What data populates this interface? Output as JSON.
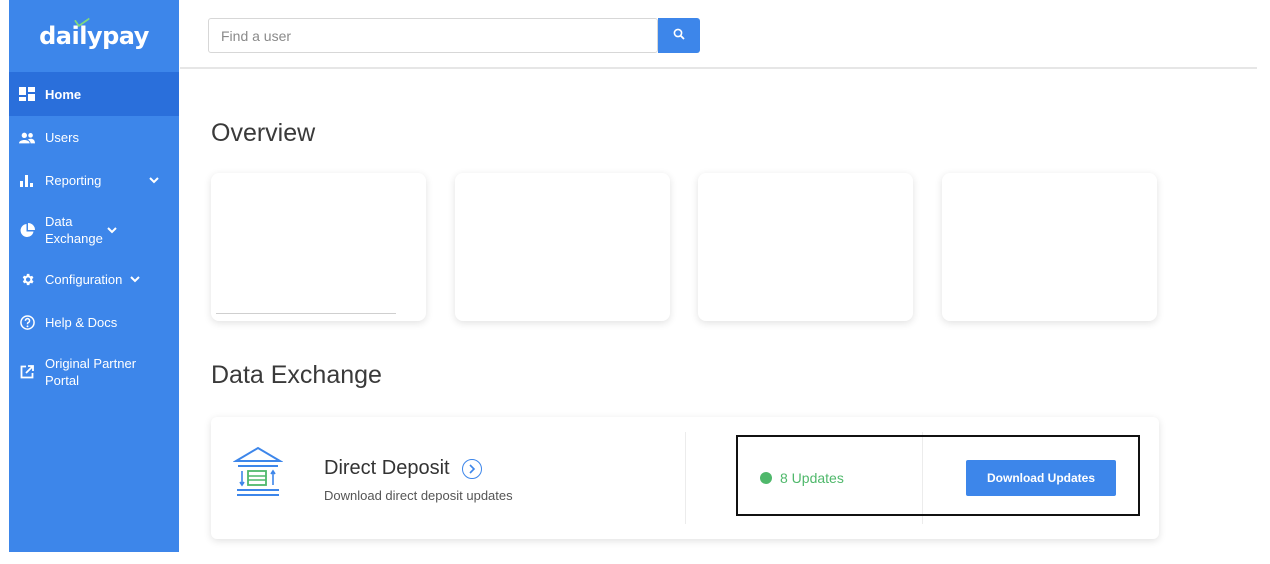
{
  "brand": {
    "logo_text": "dailypay",
    "accent_color": "#3d86ea",
    "active_color": "#2a6fdb"
  },
  "sidebar": {
    "items": [
      {
        "label": "Home",
        "icon": "dashboard-icon",
        "active": true
      },
      {
        "label": "Users",
        "icon": "users-icon"
      },
      {
        "label": "Reporting",
        "icon": "bar-chart-icon",
        "has_chevron": true
      },
      {
        "label": "Data Exchange",
        "icon": "pie-chart-icon",
        "has_chevron": true
      },
      {
        "label": "Configuration",
        "icon": "gear-icon",
        "has_chevron": true
      },
      {
        "label": "Help & Docs",
        "icon": "help-icon"
      },
      {
        "label": "Original Partner Portal",
        "icon": "external-link-icon"
      }
    ]
  },
  "search": {
    "placeholder": "Find a user",
    "value": "",
    "button_icon": "search-icon"
  },
  "overview": {
    "title": "Overview"
  },
  "data_exchange": {
    "title": "Data Exchange",
    "card": {
      "icon": "bank-transfer-icon",
      "title": "Direct Deposit",
      "subtitle": "Download direct deposit updates",
      "updates_text": "8 Updates",
      "updates_color": "#4fb86b",
      "button_label": "Download Updates"
    }
  }
}
